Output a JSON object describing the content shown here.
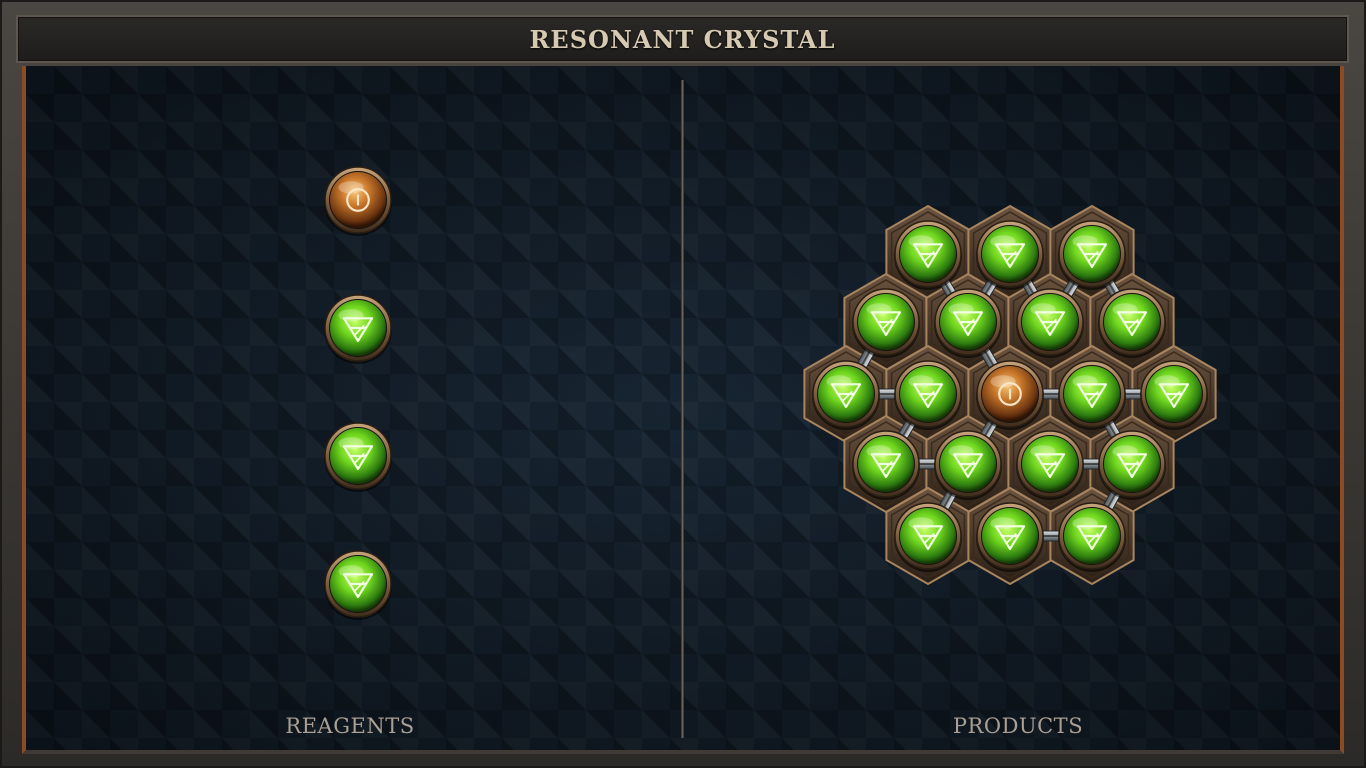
{
  "window": {
    "title": "RESONANT CRYSTAL"
  },
  "reagents": {
    "label": "REAGENTS",
    "items": [
      {
        "type": "amber",
        "icon": "circle-symbol-icon"
      },
      {
        "type": "green",
        "icon": "earth-triangle-icon"
      },
      {
        "type": "green",
        "icon": "earth-triangle-icon"
      },
      {
        "type": "green",
        "icon": "earth-triangle-icon"
      }
    ]
  },
  "products": {
    "label": "PRODUCTS",
    "cells": [
      {
        "row": 0,
        "col": 0,
        "type": "green"
      },
      {
        "row": 0,
        "col": 1,
        "type": "green"
      },
      {
        "row": 0,
        "col": 2,
        "type": "green"
      },
      {
        "row": 1,
        "col": 0,
        "type": "green"
      },
      {
        "row": 1,
        "col": 1,
        "type": "green"
      },
      {
        "row": 1,
        "col": 2,
        "type": "green"
      },
      {
        "row": 1,
        "col": 3,
        "type": "green"
      },
      {
        "row": 2,
        "col": 0,
        "type": "green"
      },
      {
        "row": 2,
        "col": 1,
        "type": "green"
      },
      {
        "row": 2,
        "col": 2,
        "type": "amber"
      },
      {
        "row": 2,
        "col": 3,
        "type": "green"
      },
      {
        "row": 2,
        "col": 4,
        "type": "green"
      },
      {
        "row": 3,
        "col": 0,
        "type": "green"
      },
      {
        "row": 3,
        "col": 1,
        "type": "green"
      },
      {
        "row": 3,
        "col": 2,
        "type": "green"
      },
      {
        "row": 3,
        "col": 3,
        "type": "green"
      },
      {
        "row": 4,
        "col": 0,
        "type": "green"
      },
      {
        "row": 4,
        "col": 1,
        "type": "green"
      },
      {
        "row": 4,
        "col": 2,
        "type": "green"
      }
    ],
    "links": [
      [
        [
          0,
          0
        ],
        [
          1,
          1
        ]
      ],
      [
        [
          0,
          1
        ],
        [
          1,
          1
        ]
      ],
      [
        [
          0,
          1
        ],
        [
          1,
          2
        ]
      ],
      [
        [
          0,
          2
        ],
        [
          1,
          2
        ]
      ],
      [
        [
          0,
          2
        ],
        [
          1,
          3
        ]
      ],
      [
        [
          1,
          0
        ],
        [
          2,
          0
        ]
      ],
      [
        [
          1,
          1
        ],
        [
          2,
          2
        ]
      ],
      [
        [
          2,
          0
        ],
        [
          2,
          1
        ]
      ],
      [
        [
          2,
          2
        ],
        [
          2,
          3
        ]
      ],
      [
        [
          2,
          3
        ],
        [
          2,
          4
        ]
      ],
      [
        [
          2,
          1
        ],
        [
          3,
          0
        ]
      ],
      [
        [
          2,
          2
        ],
        [
          3,
          1
        ]
      ],
      [
        [
          2,
          3
        ],
        [
          3,
          3
        ]
      ],
      [
        [
          3,
          0
        ],
        [
          3,
          1
        ]
      ],
      [
        [
          3,
          2
        ],
        [
          3,
          3
        ]
      ],
      [
        [
          3,
          1
        ],
        [
          4,
          0
        ]
      ],
      [
        [
          3,
          3
        ],
        [
          4,
          2
        ]
      ],
      [
        [
          4,
          1
        ],
        [
          4,
          2
        ]
      ]
    ]
  },
  "colors": {
    "green_core": "#9df23a",
    "green_dark": "#1f5a0c",
    "amber_core": "#e8a347",
    "amber_dark": "#4a2208",
    "bronze": "#8a6b4a",
    "accent_border": "#8a4b25"
  }
}
